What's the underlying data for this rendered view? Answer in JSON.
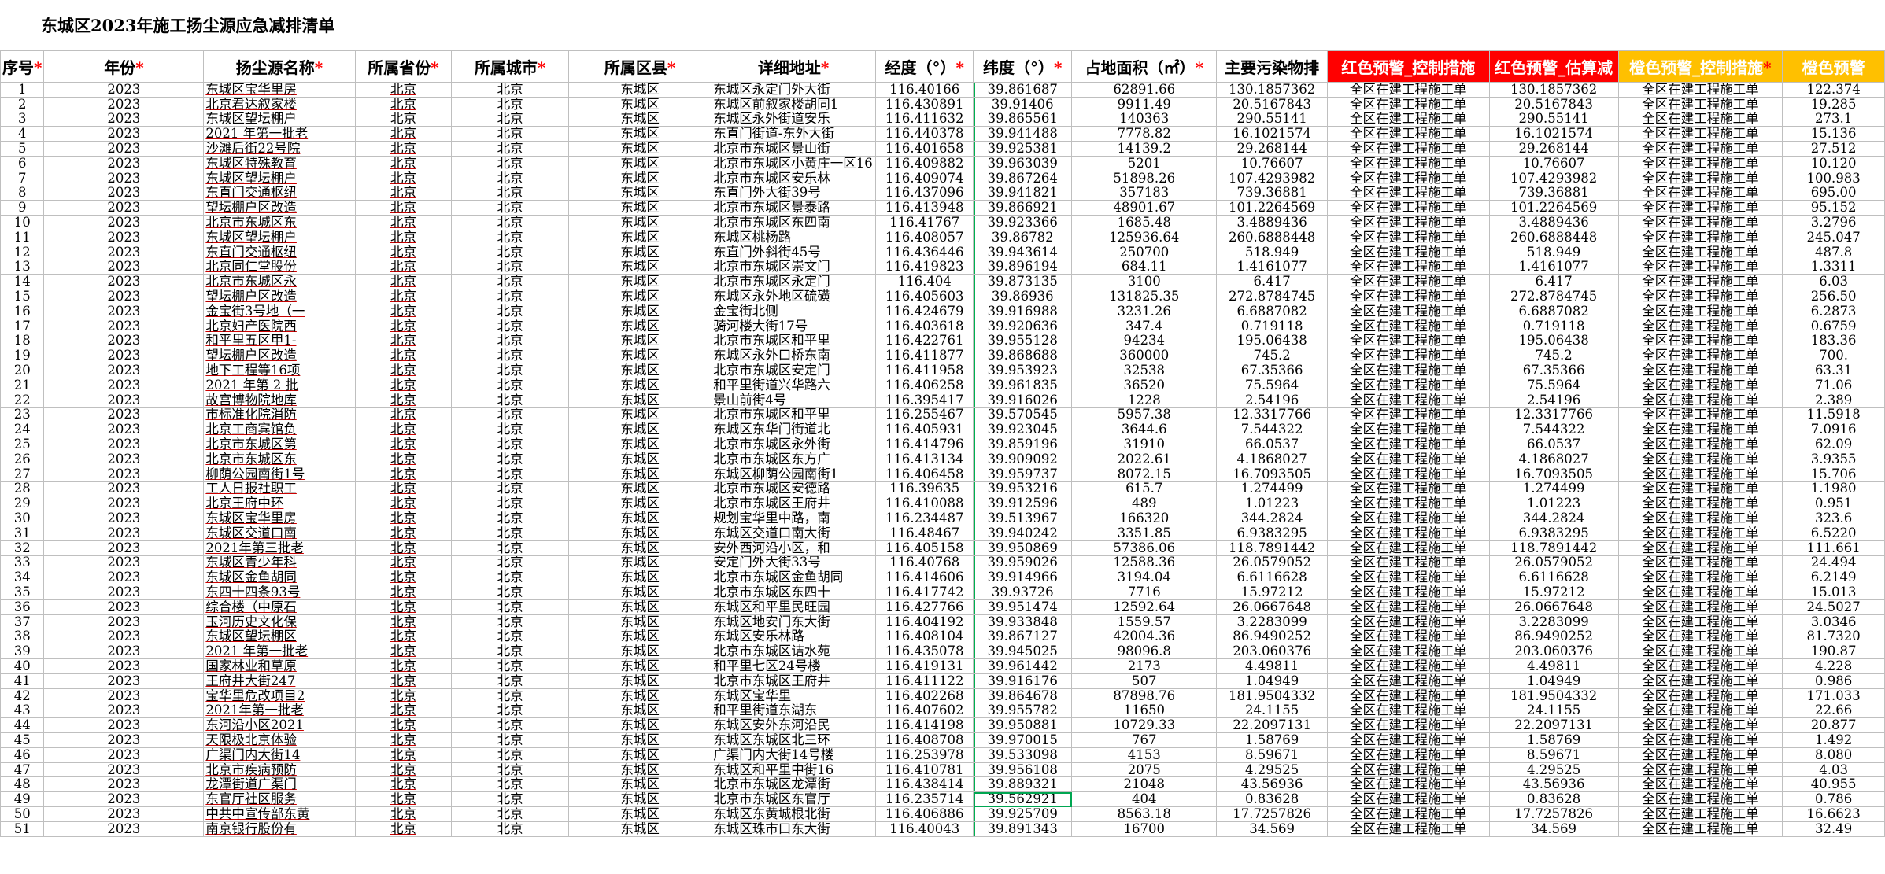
{
  "title": "东城区2023年施工扬尘源应急减排清单",
  "headers": [
    {
      "label": "序号",
      "req": "*"
    },
    {
      "label": "年份",
      "req": "*"
    },
    {
      "label": "扬尘源名称",
      "req": "*"
    },
    {
      "label": "所属省份",
      "req": "*"
    },
    {
      "label": "所属城市",
      "req": "*"
    },
    {
      "label": "所属区县",
      "req": "*"
    },
    {
      "label": "详细地址",
      "req": "*"
    },
    {
      "label": "经度（°）",
      "req": "*"
    },
    {
      "label": "纬度（°）",
      "req": "*"
    },
    {
      "label": "占地面积（㎡）",
      "req": "*"
    },
    {
      "label": "主要污染物排",
      "req": ""
    },
    {
      "label": "红色预警_控制措施",
      "req": "",
      "style": "red"
    },
    {
      "label": "红色预警_估算减",
      "req": "",
      "style": "red"
    },
    {
      "label": "橙色预警_控制措施",
      "req": "*",
      "style": "orange"
    },
    {
      "label": "橙色预警",
      "req": "",
      "style": "orange"
    }
  ],
  "rows": [
    [
      "1",
      "2023",
      "东城区宝华里房",
      "北京",
      "北京",
      "东城区",
      "东城区永定门外大街",
      "116.40166",
      "39.861687",
      "62891.66",
      "130.1857362",
      "全区在建工程施工单",
      "130.1857362",
      "全区在建工程施工单",
      "122.374"
    ],
    [
      "2",
      "2023",
      "北京君达叙家楼",
      "北京",
      "北京",
      "东城区",
      "东城区前叙家楼胡同1",
      "116.430891",
      "39.91406",
      "9911.49",
      "20.5167843",
      "全区在建工程施工单",
      "20.5167843",
      "全区在建工程施工单",
      "19.285"
    ],
    [
      "3",
      "2023",
      "东城区望坛棚户",
      "北京",
      "北京",
      "东城区",
      "东城区永外街道安乐",
      "116.411632",
      "39.865561",
      "140363",
      "290.55141",
      "全区在建工程施工单",
      "290.55141",
      "全区在建工程施工单",
      "273.1"
    ],
    [
      "4",
      "2023",
      "2021 年第一批老",
      "北京",
      "北京",
      "东城区",
      "东直门街道-东外大街",
      "116.440378",
      "39.941488",
      "7778.82",
      "16.1021574",
      "全区在建工程施工单",
      "16.1021574",
      "全区在建工程施工单",
      "15.136"
    ],
    [
      "5",
      "2023",
      "沙滩后街22号院",
      "北京",
      "北京",
      "东城区",
      "北京市东城区景山街",
      "116.401658",
      "39.925381",
      "14139.2",
      "29.268144",
      "全区在建工程施工单",
      "29.268144",
      "全区在建工程施工单",
      "27.512"
    ],
    [
      "6",
      "2023",
      "东城区特殊教育",
      "北京",
      "北京",
      "东城区",
      "北京市东城区小黄庄一区16",
      "116.409882",
      "39.963039",
      "5201",
      "10.76607",
      "全区在建工程施工单",
      "10.76607",
      "全区在建工程施工单",
      "10.120"
    ],
    [
      "7",
      "2023",
      "东城区望坛棚户",
      "北京",
      "北京",
      "东城区",
      "北京市东城区安乐林",
      "116.409074",
      "39.867264",
      "51898.26",
      "107.4293982",
      "全区在建工程施工单",
      "107.4293982",
      "全区在建工程施工单",
      "100.983"
    ],
    [
      "8",
      "2023",
      "东直门交通枢纽",
      "北京",
      "北京",
      "东城区",
      "东直门外大街39号",
      "116.437096",
      "39.941821",
      "357183",
      "739.36881",
      "全区在建工程施工单",
      "739.36881",
      "全区在建工程施工单",
      "695.00"
    ],
    [
      "9",
      "2023",
      "望坛棚户区改造",
      "北京",
      "北京",
      "东城区",
      "北京市东城区景泰路",
      "116.413948",
      "39.866921",
      "48901.67",
      "101.2264569",
      "全区在建工程施工单",
      "101.2264569",
      "全区在建工程施工单",
      "95.152"
    ],
    [
      "10",
      "2023",
      "北京市东城区东",
      "北京",
      "北京",
      "东城区",
      "北京市东城区东四南",
      "116.41767",
      "39.923366",
      "1685.48",
      "3.4889436",
      "全区在建工程施工单",
      "3.4889436",
      "全区在建工程施工单",
      "3.2796"
    ],
    [
      "11",
      "2023",
      "东城区望坛棚户",
      "北京",
      "北京",
      "东城区",
      "东城区桃杨路",
      "116.408057",
      "39.86782",
      "125936.64",
      "260.6888448",
      "全区在建工程施工单",
      "260.6888448",
      "全区在建工程施工单",
      "245.047"
    ],
    [
      "12",
      "2023",
      "东直门交通枢纽",
      "北京",
      "北京",
      "东城区",
      "东直门外斜街45号",
      "116.436446",
      "39.943614",
      "250700",
      "518.949",
      "全区在建工程施工单",
      "518.949",
      "全区在建工程施工单",
      "487.8"
    ],
    [
      "13",
      "2023",
      "北京同仁堂股份",
      "北京",
      "北京",
      "东城区",
      "北京市东城区崇文门",
      "116.419823",
      "39.896194",
      "684.11",
      "1.4161077",
      "全区在建工程施工单",
      "1.4161077",
      "全区在建工程施工单",
      "1.3311"
    ],
    [
      "14",
      "2023",
      "北京市东城区永",
      "北京",
      "北京",
      "东城区",
      "北京市东城区永定门",
      "116.404",
      "39.873135",
      "3100",
      "6.417",
      "全区在建工程施工单",
      "6.417",
      "全区在建工程施工单",
      "6.03"
    ],
    [
      "15",
      "2023",
      "望坛棚户区改造",
      "北京",
      "北京",
      "东城区",
      "东城区永外地区硫磺",
      "116.405603",
      "39.86936",
      "131825.35",
      "272.8784745",
      "全区在建工程施工单",
      "272.8784745",
      "全区在建工程施工单",
      "256.50"
    ],
    [
      "16",
      "2023",
      "金宝街3号地（一",
      "北京",
      "北京",
      "东城区",
      "金宝街北侧",
      "116.424679",
      "39.916988",
      "3231.26",
      "6.6887082",
      "全区在建工程施工单",
      "6.6887082",
      "全区在建工程施工单",
      "6.2873"
    ],
    [
      "17",
      "2023",
      "北京妇产医院西",
      "北京",
      "北京",
      "东城区",
      "骑河楼大街17号",
      "116.403618",
      "39.920636",
      "347.4",
      "0.719118",
      "全区在建工程施工单",
      "0.719118",
      "全区在建工程施工单",
      "0.6759"
    ],
    [
      "18",
      "2023",
      "和平里五区甲1-",
      "北京",
      "北京",
      "东城区",
      "北京市东城区和平里",
      "116.422761",
      "39.955128",
      "94234",
      "195.06438",
      "全区在建工程施工单",
      "195.06438",
      "全区在建工程施工单",
      "183.36"
    ],
    [
      "19",
      "2023",
      "望坛棚户区改造",
      "北京",
      "北京",
      "东城区",
      "东城区永外口桥东南",
      "116.411877",
      "39.868688",
      "360000",
      "745.2",
      "全区在建工程施工单",
      "745.2",
      "全区在建工程施工单",
      "700."
    ],
    [
      "20",
      "2023",
      "地下工程等16项",
      "北京",
      "北京",
      "东城区",
      "北京市东城区安定门",
      "116.411958",
      "39.953923",
      "32538",
      "67.35366",
      "全区在建工程施工单",
      "67.35366",
      "全区在建工程施工单",
      "63.31"
    ],
    [
      "21",
      "2023",
      "2021 年第 2 批",
      "北京",
      "北京",
      "东城区",
      "和平里街道兴华路六",
      "116.406258",
      "39.961835",
      "36520",
      "75.5964",
      "全区在建工程施工单",
      "75.5964",
      "全区在建工程施工单",
      "71.06"
    ],
    [
      "22",
      "2023",
      "故宫博物院地库",
      "北京",
      "北京",
      "东城区",
      "景山前街4号",
      "116.395417",
      "39.916026",
      "1228",
      "2.54196",
      "全区在建工程施工单",
      "2.54196",
      "全区在建工程施工单",
      "2.389"
    ],
    [
      "23",
      "2023",
      "市标准化院消防",
      "北京",
      "北京",
      "东城区",
      "北京市东城区和平里",
      "116.255467",
      "39.570545",
      "5957.38",
      "12.3317766",
      "全区在建工程施工单",
      "12.3317766",
      "全区在建工程施工单",
      "11.5918"
    ],
    [
      "24",
      "2023",
      "北京工商宾馆负",
      "北京",
      "北京",
      "东城区",
      "东城区东华门街道北",
      "116.405931",
      "39.923045",
      "3644.6",
      "7.544322",
      "全区在建工程施工单",
      "7.544322",
      "全区在建工程施工单",
      "7.0916"
    ],
    [
      "25",
      "2023",
      "北京市东城区第",
      "北京",
      "北京",
      "东城区",
      "北京市东城区永外街",
      "116.414796",
      "39.859196",
      "31910",
      "66.0537",
      "全区在建工程施工单",
      "66.0537",
      "全区在建工程施工单",
      "62.09"
    ],
    [
      "26",
      "2023",
      "北京市东城区东",
      "北京",
      "北京",
      "东城区",
      "北京市东城区东方广",
      "116.413134",
      "39.909092",
      "2022.61",
      "4.1868027",
      "全区在建工程施工单",
      "4.1868027",
      "全区在建工程施工单",
      "3.9355"
    ],
    [
      "27",
      "2023",
      "柳荫公园南街1号",
      "北京",
      "北京",
      "东城区",
      "东城区柳荫公园南街1",
      "116.406458",
      "39.959737",
      "8072.15",
      "16.7093505",
      "全区在建工程施工单",
      "16.7093505",
      "全区在建工程施工单",
      "15.706"
    ],
    [
      "28",
      "2023",
      "工人日报社职工",
      "北京",
      "北京",
      "东城区",
      "北京市东城区安德路",
      "116.39635",
      "39.953216",
      "615.7",
      "1.274499",
      "全区在建工程施工单",
      "1.274499",
      "全区在建工程施工单",
      "1.1980"
    ],
    [
      "29",
      "2023",
      "北京王府中环",
      "北京",
      "北京",
      "东城区",
      "北京市东城区王府井",
      "116.410088",
      "39.912596",
      "489",
      "1.01223",
      "全区在建工程施工单",
      "1.01223",
      "全区在建工程施工单",
      "0.951"
    ],
    [
      "30",
      "2023",
      "东城区宝华里房",
      "北京",
      "北京",
      "东城区",
      "规划宝华里中路，南",
      "116.234487",
      "39.513967",
      "166320",
      "344.2824",
      "全区在建工程施工单",
      "344.2824",
      "全区在建工程施工单",
      "323.6"
    ],
    [
      "31",
      "2023",
      "东城区交道口南",
      "北京",
      "北京",
      "东城区",
      "东城区交道口南大街",
      "116.48467",
      "39.940242",
      "3351.85",
      "6.9383295",
      "全区在建工程施工单",
      "6.9383295",
      "全区在建工程施工单",
      "6.5220"
    ],
    [
      "32",
      "2023",
      "2021年第三批老",
      "北京",
      "北京",
      "东城区",
      "安外西河沿小区，和",
      "116.405158",
      "39.950869",
      "57386.06",
      "118.7891442",
      "全区在建工程施工单",
      "118.7891442",
      "全区在建工程施工单",
      "111.661"
    ],
    [
      "33",
      "2023",
      "东城区青少年科",
      "北京",
      "北京",
      "东城区",
      "安定门外大街33号",
      "116.40768",
      "39.959026",
      "12588.36",
      "26.0579052",
      "全区在建工程施工单",
      "26.0579052",
      "全区在建工程施工单",
      "24.494"
    ],
    [
      "34",
      "2023",
      "东城区金鱼胡同",
      "北京",
      "北京",
      "东城区",
      "北京市东城区金鱼胡同",
      "116.414606",
      "39.914966",
      "3194.04",
      "6.6116628",
      "全区在建工程施工单",
      "6.6116628",
      "全区在建工程施工单",
      "6.2149"
    ],
    [
      "35",
      "2023",
      "东四十四条93号",
      "北京",
      "北京",
      "东城区",
      "北京市东城区东四十",
      "116.417742",
      "39.93726",
      "7716",
      "15.97212",
      "全区在建工程施工单",
      "15.97212",
      "全区在建工程施工单",
      "15.013"
    ],
    [
      "36",
      "2023",
      "综合楼（中原石",
      "北京",
      "北京",
      "东城区",
      "东城区和平里民旺园",
      "116.427766",
      "39.951474",
      "12592.64",
      "26.0667648",
      "全区在建工程施工单",
      "26.0667648",
      "全区在建工程施工单",
      "24.5027"
    ],
    [
      "37",
      "2023",
      "玉河历史文化保",
      "北京",
      "北京",
      "东城区",
      "东城区地安门东大街",
      "116.404192",
      "39.933848",
      "1559.57",
      "3.2283099",
      "全区在建工程施工单",
      "3.2283099",
      "全区在建工程施工单",
      "3.0346"
    ],
    [
      "38",
      "2023",
      "东城区望坛棚区",
      "北京",
      "北京",
      "东城区",
      "东城区安乐林路",
      "116.408104",
      "39.867127",
      "42004.36",
      "86.9490252",
      "全区在建工程施工单",
      "86.9490252",
      "全区在建工程施工单",
      "81.7320"
    ],
    [
      "39",
      "2023",
      "2021 年第一批老",
      "北京",
      "北京",
      "东城区",
      "北京市东城区诘水苑",
      "116.435078",
      "39.945025",
      "98096.8",
      "203.060376",
      "全区在建工程施工单",
      "203.060376",
      "全区在建工程施工单",
      "190.87"
    ],
    [
      "40",
      "2023",
      "国家林业和草原",
      "北京",
      "北京",
      "东城区",
      "和平里七区24号楼",
      "116.419131",
      "39.961442",
      "2173",
      "4.49811",
      "全区在建工程施工单",
      "4.49811",
      "全区在建工程施工单",
      "4.228"
    ],
    [
      "41",
      "2023",
      "王府井大街247",
      "北京",
      "北京",
      "东城区",
      "北京市东城区王府井",
      "116.411122",
      "39.916176",
      "507",
      "1.04949",
      "全区在建工程施工单",
      "1.04949",
      "全区在建工程施工单",
      "0.986"
    ],
    [
      "42",
      "2023",
      "宝华里危改项目2",
      "北京",
      "北京",
      "东城区",
      "东城区宝华里",
      "116.402268",
      "39.864678",
      "87898.76",
      "181.9504332",
      "全区在建工程施工单",
      "181.9504332",
      "全区在建工程施工单",
      "171.033"
    ],
    [
      "43",
      "2023",
      "2021年第一批老",
      "北京",
      "北京",
      "东城区",
      "和平里街道东湖东",
      "116.407602",
      "39.955782",
      "11650",
      "24.1155",
      "全区在建工程施工单",
      "24.1155",
      "全区在建工程施工单",
      "22.66"
    ],
    [
      "44",
      "2023",
      "东河沿小区2021",
      "北京",
      "北京",
      "东城区",
      "东城区安外东河沿民",
      "116.414198",
      "39.950881",
      "10729.33",
      "22.2097131",
      "全区在建工程施工单",
      "22.2097131",
      "全区在建工程施工单",
      "20.877"
    ],
    [
      "45",
      "2023",
      "天限极北京体验",
      "北京",
      "北京",
      "东城区",
      "东城区东城区北三环",
      "116.408708",
      "39.970015",
      "767",
      "1.58769",
      "全区在建工程施工单",
      "1.58769",
      "全区在建工程施工单",
      "1.492"
    ],
    [
      "46",
      "2023",
      "广渠门内大街14",
      "北京",
      "北京",
      "东城区",
      "广渠门内大街14号楼",
      "116.253978",
      "39.533098",
      "4153",
      "8.59671",
      "全区在建工程施工单",
      "8.59671",
      "全区在建工程施工单",
      "8.080"
    ],
    [
      "47",
      "2023",
      "北京市疾病预防",
      "北京",
      "北京",
      "东城区",
      "东城区和平里中街16",
      "116.410781",
      "39.956108",
      "2075",
      "4.29525",
      "全区在建工程施工单",
      "4.29525",
      "全区在建工程施工单",
      "4.03"
    ],
    [
      "48",
      "2023",
      "龙潭街道广渠门",
      "北京",
      "北京",
      "东城区",
      "北京市东城区龙潭街",
      "116.438414",
      "39.889321",
      "21048",
      "43.56936",
      "全区在建工程施工单",
      "43.56936",
      "全区在建工程施工单",
      "40.955"
    ],
    [
      "49",
      "2023",
      "东官厅社区服务",
      "北京",
      "北京",
      "东城区",
      "北京市东城区东官厅",
      "116.235714",
      "39.562921",
      "404",
      "0.83628",
      "全区在建工程施工单",
      "0.83628",
      "全区在建工程施工单",
      "0.786"
    ],
    [
      "50",
      "2023",
      "中共中宣传部东黄",
      "北京",
      "北京",
      "东城区",
      "东城区东黄城根北街",
      "116.406886",
      "39.925709",
      "8563.18",
      "17.7257826",
      "全区在建工程施工单",
      "17.7257826",
      "全区在建工程施工单",
      "16.6623"
    ],
    [
      "51",
      "2023",
      "南京银行股份有",
      "北京",
      "北京",
      "东城区",
      "东城区珠市口东大街",
      "116.40043",
      "39.891343",
      "16700",
      "34.569",
      "全区在建工程施工单",
      "34.569",
      "全区在建工程施工单",
      "32.49"
    ]
  ]
}
